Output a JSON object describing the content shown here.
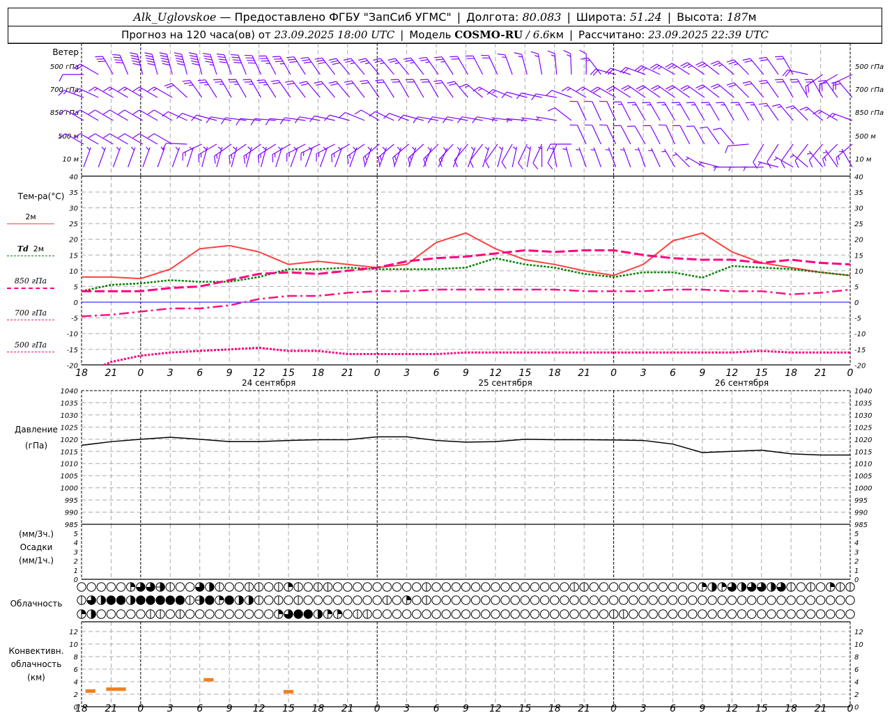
{
  "header": {
    "station": "Alk_Uglovskoe",
    "provided": "— Предоставлено ФГБУ \"ЗапСиб УГМС\"",
    "lon_label": "Долгота:",
    "lon": "80.083",
    "lat_label": "Широта:",
    "lat": "51.24",
    "alt_label": "Высота:",
    "alt": "187",
    "alt_unit": "м",
    "forecast_label": "Прогноз на 120 часа(ов) от",
    "init": "23.09.2025 18:00 UTC",
    "model_label": "Модель",
    "model": "COSMO-RU",
    "res": "/ 6.6",
    "res_unit": "км",
    "calc_label": "Рассчитано:",
    "calc": "23.09.2025 22:39 UTC"
  },
  "colors": {
    "wind": "#8000ff",
    "t2m": "#ff4040",
    "td2m": "#008000",
    "t850": "#ff0080",
    "t700": "#ff1080",
    "t500": "#ff0080",
    "zero": "#0000ff",
    "convective": "#f08020"
  },
  "time_axis": {
    "hours_from_start_step": 3,
    "tick_labels": [
      "18",
      "21",
      "0",
      "3",
      "6",
      "9",
      "12",
      "15",
      "18",
      "21",
      "0",
      "3",
      "6",
      "9",
      "12",
      "15",
      "18",
      "21",
      "0",
      "3",
      "6",
      "9",
      "12",
      "15",
      "18",
      "21",
      "0"
    ],
    "dates": [
      "24 сентября",
      "25 сентября",
      "26 сентября"
    ]
  },
  "chart_data": [
    {
      "type": "wind-barbs",
      "title": "Ветер",
      "units": "m/s",
      "levels": [
        {
          "label": "500 гПа",
          "dir": [
            270,
            330,
            345,
            345,
            345,
            340,
            335,
            330,
            325,
            320,
            320,
            320,
            325,
            330,
            335,
            345,
            355,
            0,
            285,
            290,
            300,
            305,
            310,
            320,
            330,
            235,
            245
          ],
          "speed": [
            6,
            15,
            25,
            25,
            25,
            22,
            20,
            18,
            16,
            15,
            14,
            14,
            13,
            12,
            10,
            9,
            8,
            7,
            10,
            12,
            13,
            13,
            13,
            12,
            10,
            10,
            12
          ]
        },
        {
          "label": "700 гПа",
          "dir": [
            290,
            300,
            300,
            300,
            325,
            330,
            330,
            325,
            320,
            320,
            325,
            330,
            330,
            320,
            300,
            285,
            280,
            300,
            300,
            305,
            305,
            305,
            310,
            320,
            330,
            330,
            320
          ],
          "speed": [
            8,
            8,
            8,
            8,
            14,
            14,
            14,
            12,
            12,
            12,
            12,
            12,
            12,
            10,
            8,
            7,
            6,
            8,
            10,
            12,
            12,
            12,
            12,
            12,
            10,
            10,
            10
          ]
        },
        {
          "label": "850 гПа",
          "dir": [
            300,
            300,
            300,
            300,
            290,
            280,
            275,
            275,
            280,
            285,
            300,
            290,
            280,
            280,
            280,
            275,
            280,
            335,
            335,
            330,
            330,
            330,
            330,
            330,
            320,
            310,
            290
          ],
          "speed": [
            5,
            6,
            6,
            5,
            6,
            6,
            5,
            5,
            5,
            5,
            5,
            6,
            6,
            5,
            5,
            4,
            4,
            6,
            7,
            8,
            8,
            8,
            9,
            9,
            8,
            8,
            8
          ]
        },
        {
          "label": "500 м",
          "dir": [
            300,
            300,
            300,
            300,
            245,
            235,
            235,
            240,
            245,
            240,
            230,
            230,
            225,
            220,
            215,
            205,
            205,
            335,
            335,
            330,
            335,
            330,
            320,
            210,
            215,
            220,
            230
          ],
          "speed": [
            5,
            6,
            6,
            5,
            8,
            8,
            8,
            9,
            9,
            9,
            9,
            8,
            8,
            7,
            7,
            6,
            6,
            6,
            6,
            6,
            6,
            6,
            6,
            6,
            7,
            7,
            8
          ]
        },
        {
          "label": "10   м",
          "dir": [
            20,
            20,
            20,
            20,
            15,
            15,
            15,
            20,
            20,
            20,
            20,
            20,
            25,
            20,
            15,
            10,
            350,
            340,
            340,
            340,
            330,
            300,
            270,
            270,
            300,
            320,
            330
          ],
          "speed": [
            3,
            4,
            4,
            4,
            3,
            3,
            3,
            3,
            3,
            3,
            3,
            3,
            4,
            4,
            3,
            3,
            3,
            3,
            3,
            3,
            3,
            3,
            3,
            3,
            3,
            3,
            3
          ]
        }
      ]
    },
    {
      "type": "line",
      "title": "Тем-ра(°C)",
      "ylim": [
        -20,
        40
      ],
      "yticks": [
        -20,
        -15,
        -10,
        -5,
        0,
        5,
        10,
        15,
        20,
        25,
        30,
        35,
        40
      ],
      "grid": true,
      "series": [
        {
          "name": "2м",
          "prefix": "",
          "values": [
            8,
            8,
            7.5,
            10.5,
            17,
            18,
            16,
            12,
            13,
            12,
            11,
            12,
            19,
            22,
            17,
            13.5,
            12,
            10,
            8.5,
            12,
            19.5,
            22,
            16,
            12.5,
            11,
            9.5,
            8.5
          ]
        },
        {
          "name": "2м",
          "prefix": "Td",
          "values": [
            3.5,
            5.5,
            6,
            7,
            6.5,
            6.5,
            8,
            10.5,
            10.5,
            11,
            10.5,
            10.5,
            10.5,
            11,
            14,
            12,
            11,
            9,
            8,
            9.5,
            9.5,
            7.8,
            11.5,
            11,
            10.5,
            9.5,
            8.5
          ]
        },
        {
          "name": "850 гПа",
          "prefix": "",
          "values": [
            3.5,
            3.5,
            3.5,
            4.5,
            5,
            7,
            9,
            9.5,
            9,
            10,
            11,
            13,
            14,
            14.5,
            15.5,
            16.5,
            16,
            16.5,
            16.5,
            15,
            14,
            13.5,
            13.5,
            12.5,
            13.5,
            12.5,
            12
          ]
        },
        {
          "name": "700 гПа",
          "prefix": "",
          "values": [
            -4.5,
            -4,
            -3,
            -2,
            -2,
            -1,
            1,
            2,
            2,
            3,
            3.5,
            3.5,
            4,
            4,
            4,
            4,
            4,
            3.5,
            3.5,
            3.5,
            4,
            4,
            3.5,
            3.5,
            2.5,
            3,
            4
          ]
        },
        {
          "name": "500 гПа",
          "prefix": "",
          "values": [
            -23,
            -19,
            -17,
            -16,
            -15.5,
            -15,
            -14.5,
            -15.5,
            -15.5,
            -16.5,
            -16.5,
            -16.5,
            -16.5,
            -16,
            -16,
            -16,
            -16,
            -16,
            -16,
            -16,
            -16,
            -16,
            -16,
            -15.5,
            -16,
            -16,
            -16
          ]
        }
      ]
    },
    {
      "type": "line",
      "title": "Давление",
      "ylabel": "(гПа)",
      "ylim": [
        985,
        1040
      ],
      "yticks": [
        985,
        990,
        995,
        1000,
        1005,
        1010,
        1015,
        1020,
        1025,
        1030,
        1035,
        1040
      ],
      "grid": true,
      "values": [
        1017.5,
        1019,
        1020,
        1020.8,
        1020,
        1019,
        1019,
        1019.5,
        1019.8,
        1019.8,
        1021,
        1021,
        1019.5,
        1018.8,
        1019,
        1020,
        1019.8,
        1019.8,
        1019.7,
        1019.5,
        1018,
        1014.5,
        1015,
        1015.5,
        1014,
        1013.5,
        1013.5
      ]
    },
    {
      "type": "bar",
      "title": "Осадки",
      "ylabel_top": "(мм/3ч.)",
      "ylabel_bottom": "(мм/1ч.)",
      "yticks": [
        0,
        1,
        2,
        3,
        4,
        5
      ],
      "values": []
    },
    {
      "type": "symbols",
      "title": "Облачность",
      "encoding": "oktas per hour (0 clear … 8 overcast)",
      "rows": [
        "0000026671006410011012101100000000010000000000000011000000000002426466461010211",
        "1648848888817828441010100000000102010000000000000000000000000000000000000000000",
        "2400000110100000000026884220110000000000000000000000001100000000000000000000000"
      ]
    },
    {
      "type": "bar",
      "title": "Конвективн.",
      "title2": "облачность",
      "ylabel": "(км)",
      "ylim": [
        0,
        13
      ],
      "yticks": [
        0,
        2,
        4,
        6,
        8,
        10,
        12
      ],
      "bars": [
        {
          "from_hour": 0.4,
          "to_hour": 1.4,
          "top_km": 2.5
        },
        {
          "from_hour": 2.5,
          "to_hour": 4.5,
          "top_km": 2.8
        },
        {
          "from_hour": 12.4,
          "to_hour": 13.4,
          "top_km": 4.3
        },
        {
          "from_hour": 20.5,
          "to_hour": 21.5,
          "top_km": 2.4
        }
      ]
    }
  ]
}
